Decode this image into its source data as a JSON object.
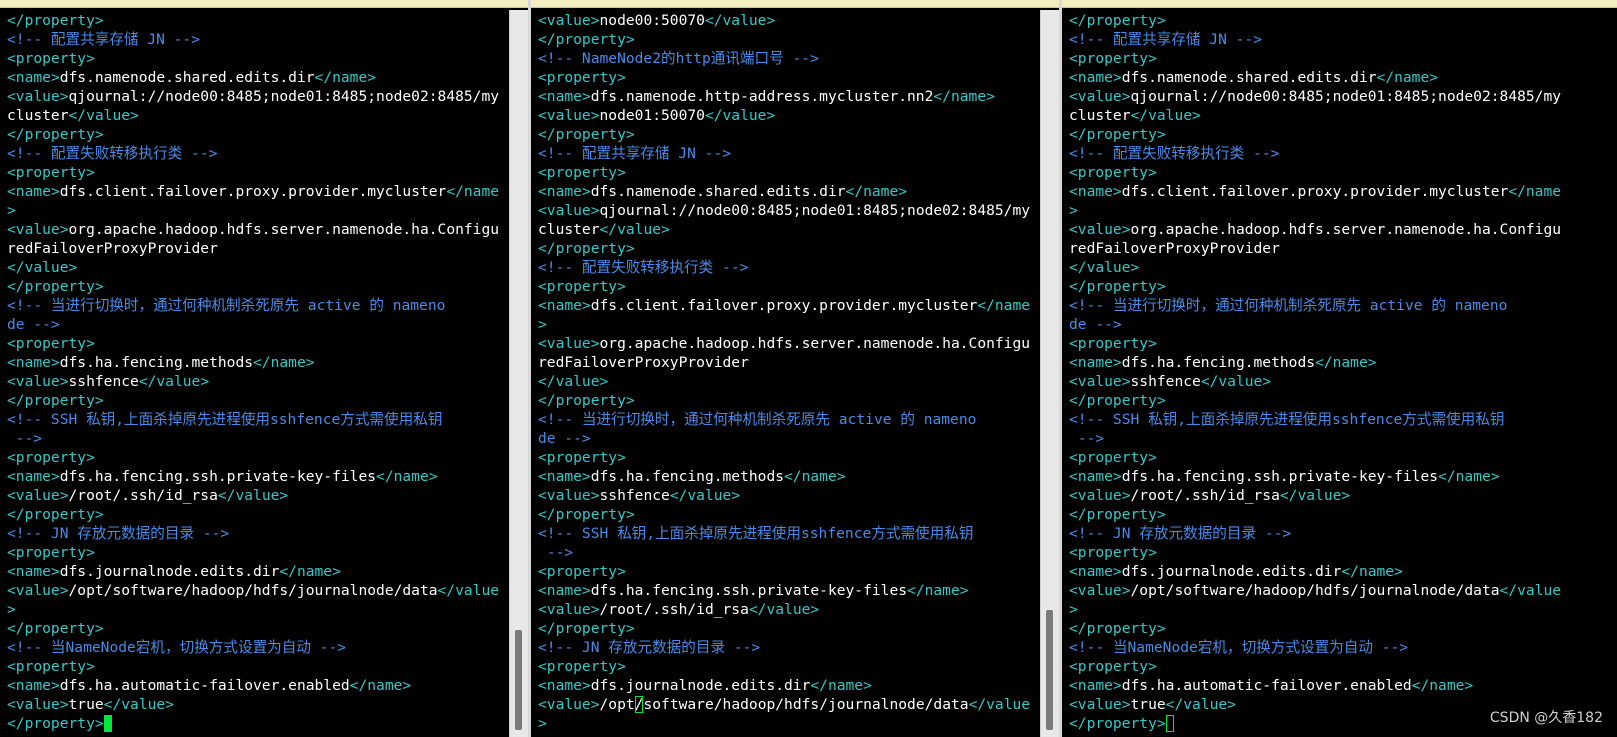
{
  "panes": [
    {
      "name": "terminal-pane-1",
      "lines": [
        [
          [
            "tag",
            "</property>"
          ]
        ],
        [
          [
            "cmt",
            "<!-- 配置共享存储 JN -->"
          ]
        ],
        [
          [
            "tag",
            "<property>"
          ]
        ],
        [
          [
            "tag",
            "<name>"
          ],
          [
            "txt",
            "dfs.namenode.shared.edits.dir"
          ],
          [
            "tag",
            "</name>"
          ]
        ],
        [
          [
            "tag",
            "<value>"
          ],
          [
            "txt",
            "qjournal://node00:8485;node01:8485;node02:8485/my"
          ]
        ],
        [
          [
            "txt",
            "cluster"
          ],
          [
            "tag",
            "</value>"
          ]
        ],
        [
          [
            "tag",
            "</property>"
          ]
        ],
        [
          [
            "cmt",
            "<!-- 配置失败转移执行类 -->"
          ]
        ],
        [
          [
            "tag",
            "<property>"
          ]
        ],
        [
          [
            "tag",
            "<name>"
          ],
          [
            "txt",
            "dfs.client.failover.proxy.provider.mycluster"
          ],
          [
            "tag",
            "</name"
          ]
        ],
        [
          [
            "tag",
            ">"
          ]
        ],
        [
          [
            "tag",
            "<value>"
          ],
          [
            "txt",
            "org.apache.hadoop.hdfs.server.namenode.ha.Configu"
          ]
        ],
        [
          [
            "txt",
            "redFailoverProxyProvider"
          ]
        ],
        [
          [
            "tag",
            "</value>"
          ]
        ],
        [
          [
            "tag",
            "</property>"
          ]
        ],
        [
          [
            "cmt",
            "<!-- 当进行切换时，通过何种机制杀死原先 active 的 nameno"
          ]
        ],
        [
          [
            "cmt",
            "de -->"
          ]
        ],
        [
          [
            "tag",
            "<property>"
          ]
        ],
        [
          [
            "tag",
            "<name>"
          ],
          [
            "txt",
            "dfs.ha.fencing.methods"
          ],
          [
            "tag",
            "</name>"
          ]
        ],
        [
          [
            "tag",
            "<value>"
          ],
          [
            "txt",
            "sshfence"
          ],
          [
            "tag",
            "</value>"
          ]
        ],
        [
          [
            "tag",
            "</property>"
          ]
        ],
        [
          [
            "cmt",
            "<!-- SSH 私钥,上面杀掉原先进程使用sshfence方式需使用私钥"
          ]
        ],
        [
          [
            "cmt",
            " -->"
          ]
        ],
        [
          [
            "tag",
            "<property>"
          ]
        ],
        [
          [
            "tag",
            "<name>"
          ],
          [
            "txt",
            "dfs.ha.fencing.ssh.private-key-files"
          ],
          [
            "tag",
            "</name>"
          ]
        ],
        [
          [
            "tag",
            "<value>"
          ],
          [
            "txt",
            "/root/.ssh/id_rsa"
          ],
          [
            "tag",
            "</value>"
          ]
        ],
        [
          [
            "tag",
            "</property>"
          ]
        ],
        [
          [
            "cmt",
            "<!-- JN 存放元数据的目录 -->"
          ]
        ],
        [
          [
            "tag",
            "<property>"
          ]
        ],
        [
          [
            "tag",
            "<name>"
          ],
          [
            "txt",
            "dfs.journalnode.edits.dir"
          ],
          [
            "tag",
            "</name>"
          ]
        ],
        [
          [
            "tag",
            "<value>"
          ],
          [
            "txt",
            "/opt/software/hadoop/hdfs/journalnode/data"
          ],
          [
            "tag",
            "</value"
          ]
        ],
        [
          [
            "tag",
            ">"
          ]
        ],
        [
          [
            "tag",
            "</property>"
          ]
        ],
        [
          [
            "cmt",
            "<!-- 当NameNode宕机，切换方式设置为自动 -->"
          ]
        ],
        [
          [
            "tag",
            "<property>"
          ]
        ],
        [
          [
            "tag",
            "<name>"
          ],
          [
            "txt",
            "dfs.ha.automatic-failover.enabled"
          ],
          [
            "tag",
            "</name>"
          ]
        ],
        [
          [
            "tag",
            "<value>"
          ],
          [
            "txt",
            "true"
          ],
          [
            "tag",
            "</value>"
          ]
        ],
        [
          [
            "tag",
            "</property>"
          ],
          [
            "cursor-solid",
            " "
          ]
        ]
      ]
    },
    {
      "name": "terminal-pane-2",
      "lines": [
        [
          [
            "tag",
            "<value>"
          ],
          [
            "txt",
            "node00:50070"
          ],
          [
            "tag",
            "</value>"
          ]
        ],
        [
          [
            "tag",
            "</property>"
          ]
        ],
        [
          [
            "cmt",
            "<!-- NameNode2的http通讯端口号 -->"
          ]
        ],
        [
          [
            "tag",
            "<property>"
          ]
        ],
        [
          [
            "tag",
            "<name>"
          ],
          [
            "txt",
            "dfs.namenode.http-address.mycluster.nn2"
          ],
          [
            "tag",
            "</name>"
          ]
        ],
        [
          [
            "tag",
            "<value>"
          ],
          [
            "txt",
            "node01:50070"
          ],
          [
            "tag",
            "</value>"
          ]
        ],
        [
          [
            "tag",
            "</property>"
          ]
        ],
        [
          [
            "cmt",
            "<!-- 配置共享存储 JN -->"
          ]
        ],
        [
          [
            "tag",
            "<property>"
          ]
        ],
        [
          [
            "tag",
            "<name>"
          ],
          [
            "txt",
            "dfs.namenode.shared.edits.dir"
          ],
          [
            "tag",
            "</name>"
          ]
        ],
        [
          [
            "tag",
            "<value>"
          ],
          [
            "txt",
            "qjournal://node00:8485;node01:8485;node02:8485/my"
          ]
        ],
        [
          [
            "txt",
            "cluster"
          ],
          [
            "tag",
            "</value>"
          ]
        ],
        [
          [
            "tag",
            "</property>"
          ]
        ],
        [
          [
            "cmt",
            "<!-- 配置失败转移执行类 -->"
          ]
        ],
        [
          [
            "tag",
            "<property>"
          ]
        ],
        [
          [
            "tag",
            "<name>"
          ],
          [
            "txt",
            "dfs.client.failover.proxy.provider.mycluster"
          ],
          [
            "tag",
            "</name"
          ]
        ],
        [
          [
            "tag",
            ">"
          ]
        ],
        [
          [
            "tag",
            "<value>"
          ],
          [
            "txt",
            "org.apache.hadoop.hdfs.server.namenode.ha.Configu"
          ]
        ],
        [
          [
            "txt",
            "redFailoverProxyProvider"
          ]
        ],
        [
          [
            "tag",
            "</value>"
          ]
        ],
        [
          [
            "tag",
            "</property>"
          ]
        ],
        [
          [
            "cmt",
            "<!-- 当进行切换时，通过何种机制杀死原先 active 的 nameno"
          ]
        ],
        [
          [
            "cmt",
            "de -->"
          ]
        ],
        [
          [
            "tag",
            "<property>"
          ]
        ],
        [
          [
            "tag",
            "<name>"
          ],
          [
            "txt",
            "dfs.ha.fencing.methods"
          ],
          [
            "tag",
            "</name>"
          ]
        ],
        [
          [
            "tag",
            "<value>"
          ],
          [
            "txt",
            "sshfence"
          ],
          [
            "tag",
            "</value>"
          ]
        ],
        [
          [
            "tag",
            "</property>"
          ]
        ],
        [
          [
            "cmt",
            "<!-- SSH 私钥,上面杀掉原先进程使用sshfence方式需使用私钥"
          ]
        ],
        [
          [
            "cmt",
            " -->"
          ]
        ],
        [
          [
            "tag",
            "<property>"
          ]
        ],
        [
          [
            "tag",
            "<name>"
          ],
          [
            "txt",
            "dfs.ha.fencing.ssh.private-key-files"
          ],
          [
            "tag",
            "</name>"
          ]
        ],
        [
          [
            "tag",
            "<value>"
          ],
          [
            "txt",
            "/root/.ssh/id_rsa"
          ],
          [
            "tag",
            "</value>"
          ]
        ],
        [
          [
            "tag",
            "</property>"
          ]
        ],
        [
          [
            "cmt",
            "<!-- JN 存放元数据的目录 -->"
          ]
        ],
        [
          [
            "tag",
            "<property>"
          ]
        ],
        [
          [
            "tag",
            "<name>"
          ],
          [
            "txt",
            "dfs.journalnode.edits.dir"
          ],
          [
            "tag",
            "</name>"
          ]
        ],
        [
          [
            "tag",
            "<value>"
          ],
          [
            "txt",
            "/opt"
          ],
          [
            "cursor-box",
            "/"
          ],
          [
            "txt",
            "software/hadoop/hdfs/journalnode/data"
          ],
          [
            "tag",
            "</value"
          ]
        ],
        [
          [
            "tag",
            ">"
          ]
        ]
      ]
    },
    {
      "name": "terminal-pane-3",
      "lines": [
        [
          [
            "tag",
            "</property>"
          ]
        ],
        [
          [
            "cmt",
            "<!-- 配置共享存储 JN -->"
          ]
        ],
        [
          [
            "tag",
            "<property>"
          ]
        ],
        [
          [
            "tag",
            "<name>"
          ],
          [
            "txt",
            "dfs.namenode.shared.edits.dir"
          ],
          [
            "tag",
            "</name>"
          ]
        ],
        [
          [
            "tag",
            "<value>"
          ],
          [
            "txt",
            "qjournal://node00:8485;node01:8485;node02:8485/my"
          ]
        ],
        [
          [
            "txt",
            "cluster"
          ],
          [
            "tag",
            "</value>"
          ]
        ],
        [
          [
            "tag",
            "</property>"
          ]
        ],
        [
          [
            "cmt",
            "<!-- 配置失败转移执行类 -->"
          ]
        ],
        [
          [
            "tag",
            "<property>"
          ]
        ],
        [
          [
            "tag",
            "<name>"
          ],
          [
            "txt",
            "dfs.client.failover.proxy.provider.mycluster"
          ],
          [
            "tag",
            "</name"
          ]
        ],
        [
          [
            "tag",
            ">"
          ]
        ],
        [
          [
            "tag",
            "<value>"
          ],
          [
            "txt",
            "org.apache.hadoop.hdfs.server.namenode.ha.Configu"
          ]
        ],
        [
          [
            "txt",
            "redFailoverProxyProvider"
          ]
        ],
        [
          [
            "tag",
            "</value>"
          ]
        ],
        [
          [
            "tag",
            "</property>"
          ]
        ],
        [
          [
            "cmt",
            "<!-- 当进行切换时，通过何种机制杀死原先 active 的 nameno"
          ]
        ],
        [
          [
            "cmt",
            "de -->"
          ]
        ],
        [
          [
            "tag",
            "<property>"
          ]
        ],
        [
          [
            "tag",
            "<name>"
          ],
          [
            "txt",
            "dfs.ha.fencing.methods"
          ],
          [
            "tag",
            "</name>"
          ]
        ],
        [
          [
            "tag",
            "<value>"
          ],
          [
            "txt",
            "sshfence"
          ],
          [
            "tag",
            "</value>"
          ]
        ],
        [
          [
            "tag",
            "</property>"
          ]
        ],
        [
          [
            "cmt",
            "<!-- SSH 私钥,上面杀掉原先进程使用sshfence方式需使用私钥"
          ]
        ],
        [
          [
            "cmt",
            " -->"
          ]
        ],
        [
          [
            "tag",
            "<property>"
          ]
        ],
        [
          [
            "tag",
            "<name>"
          ],
          [
            "txt",
            "dfs.ha.fencing.ssh.private-key-files"
          ],
          [
            "tag",
            "</name>"
          ]
        ],
        [
          [
            "tag",
            "<value>"
          ],
          [
            "txt",
            "/root/.ssh/id_rsa"
          ],
          [
            "tag",
            "</value>"
          ]
        ],
        [
          [
            "tag",
            "</property>"
          ]
        ],
        [
          [
            "cmt",
            "<!-- JN 存放元数据的目录 -->"
          ]
        ],
        [
          [
            "tag",
            "<property>"
          ]
        ],
        [
          [
            "tag",
            "<name>"
          ],
          [
            "txt",
            "dfs.journalnode.edits.dir"
          ],
          [
            "tag",
            "</name>"
          ]
        ],
        [
          [
            "tag",
            "<value>"
          ],
          [
            "txt",
            "/opt/software/hadoop/hdfs/journalnode/data"
          ],
          [
            "tag",
            "</value"
          ]
        ],
        [
          [
            "tag",
            ">"
          ]
        ],
        [
          [
            "tag",
            "</property>"
          ]
        ],
        [
          [
            "cmt",
            "<!-- 当NameNode宕机，切换方式设置为自动 -->"
          ]
        ],
        [
          [
            "tag",
            "<property>"
          ]
        ],
        [
          [
            "tag",
            "<name>"
          ],
          [
            "txt",
            "dfs.ha.automatic-failover.enabled"
          ],
          [
            "tag",
            "</name>"
          ]
        ],
        [
          [
            "tag",
            "<value>"
          ],
          [
            "txt",
            "true"
          ],
          [
            "tag",
            "</value>"
          ]
        ],
        [
          [
            "tag",
            "</property>"
          ],
          [
            "cursor-box",
            " "
          ]
        ]
      ]
    }
  ],
  "watermark": "CSDN @久香182"
}
